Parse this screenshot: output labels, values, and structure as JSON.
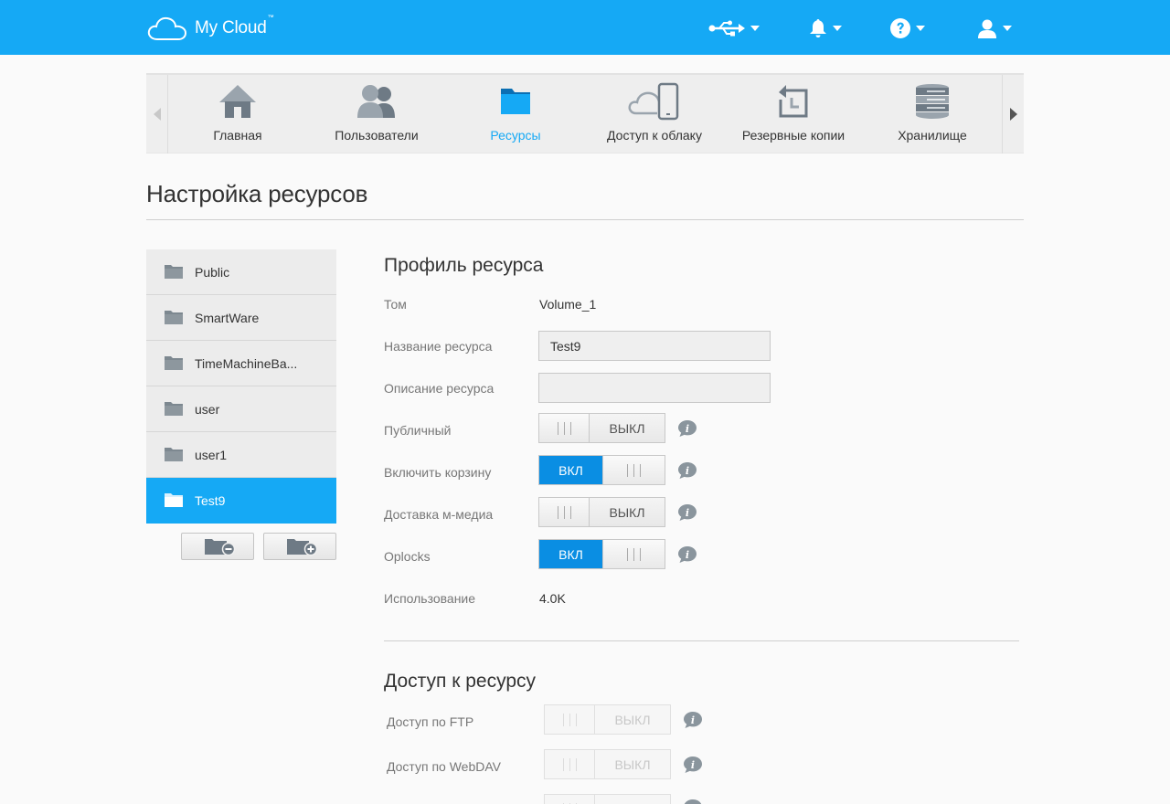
{
  "header": {
    "brand": "My Cloud",
    "trademark": "™",
    "icons": [
      "usb-icon",
      "bell-icon",
      "help-icon",
      "user-icon"
    ]
  },
  "nav": {
    "items": [
      {
        "label": "Главная",
        "icon": "home-icon"
      },
      {
        "label": "Пользователи",
        "icon": "users-icon"
      },
      {
        "label": "Ресурсы",
        "icon": "folder-icon",
        "active": true
      },
      {
        "label": "Доступ к облаку",
        "icon": "cloud-device-icon"
      },
      {
        "label": "Резервные копии",
        "icon": "backup-icon"
      },
      {
        "label": "Хранилище",
        "icon": "storage-icon"
      }
    ]
  },
  "page": {
    "title": "Настройка ресурсов"
  },
  "shares": {
    "items": [
      {
        "name": "Public"
      },
      {
        "name": "SmartWare"
      },
      {
        "name": "TimeMachineBa..."
      },
      {
        "name": "user"
      },
      {
        "name": "user1"
      },
      {
        "name": "Test9",
        "active": true
      }
    ]
  },
  "profile": {
    "title": "Профиль ресурса",
    "volume_label": "Том",
    "volume_value": "Volume_1",
    "name_label": "Название ресурса",
    "name_value": "Test9",
    "desc_label": "Описание ресурса",
    "desc_value": "",
    "public_label": "Публичный",
    "public_state": "ВЫКЛ",
    "recycle_label": "Включить корзину",
    "recycle_state": "ВКЛ",
    "media_label": "Доставка м-медиа",
    "media_state": "ВЫКЛ",
    "oplocks_label": "Oplocks",
    "oplocks_state": "ВКЛ",
    "usage_label": "Использование",
    "usage_value": "4.0K"
  },
  "access": {
    "title": "Доступ к ресурсу",
    "ftp_label": "Доступ по FTP",
    "ftp_state": "ВЫКЛ",
    "webdav_label": "Доступ по WebDAV",
    "webdav_state": "ВЫКЛ"
  },
  "colors": {
    "accent": "#15a9f5",
    "toggle_on": "#0a8ee3"
  }
}
